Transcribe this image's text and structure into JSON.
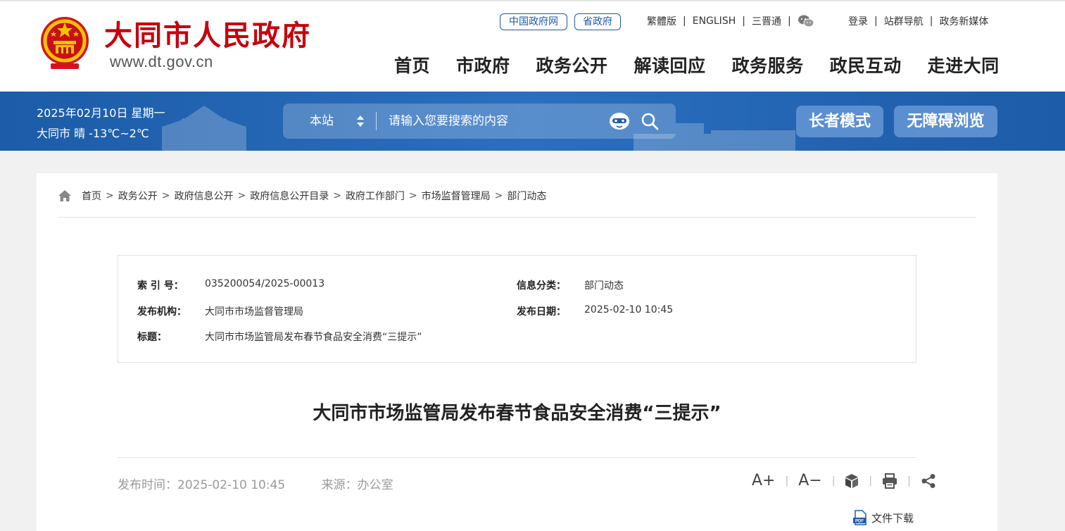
{
  "header": {
    "site_name": "大同市人民政府",
    "site_url": "www.dt.gov.cn",
    "pills": [
      "中国政府网",
      "省政府"
    ],
    "top_left_links": [
      "繁體版",
      "ENGLISH",
      "三晋通"
    ],
    "top_right_links": [
      "登录",
      "站群导航",
      "政务新媒体"
    ],
    "nav": [
      "首页",
      "市政府",
      "政务公开",
      "解读回应",
      "政务服务",
      "政民互动",
      "走进大同"
    ]
  },
  "band": {
    "date": "2025年02月10日 星期一",
    "weather": "大同市 晴 -13℃~2℃",
    "search_scope": "本站",
    "search_placeholder": "请输入您要搜索的内容",
    "elder_mode": "长者模式",
    "accessible": "无障碍浏览"
  },
  "breadcrumb": [
    "首页",
    "政务公开",
    "政府信息公开",
    "政府信息公开目录",
    "政府工作部门",
    "市场监督管理局",
    "部门动态"
  ],
  "info": {
    "index_label": "索 引 号：",
    "index_value": "035200054/2025-00013",
    "category_label": "信息分类：",
    "category_value": "部门动态",
    "org_label": "发布机构：",
    "org_value": "大同市市场监督管理局",
    "date_label": "发布日期：",
    "date_value": "2025-02-10 10:45",
    "title_label": "标题：",
    "title_value": "大同市市场监管局发布春节食品安全消费“三提示”"
  },
  "article": {
    "title": "大同市市场监管局发布春节食品安全消费“三提示”",
    "publish_time": "发布时间：2025-02-10 10:45",
    "source": "来源：办公室",
    "font_up": "A+",
    "font_down": "A−",
    "download": "文件下载"
  },
  "colors": {
    "brand_red": "#c7000b",
    "band_blue": "#1c5ca8",
    "link_blue": "#1f5aa6"
  },
  "icons": [
    "home-icon",
    "wechat-icon",
    "robot-icon",
    "search-icon",
    "cube-icon",
    "print-icon",
    "share-icon",
    "pdf-icon"
  ]
}
